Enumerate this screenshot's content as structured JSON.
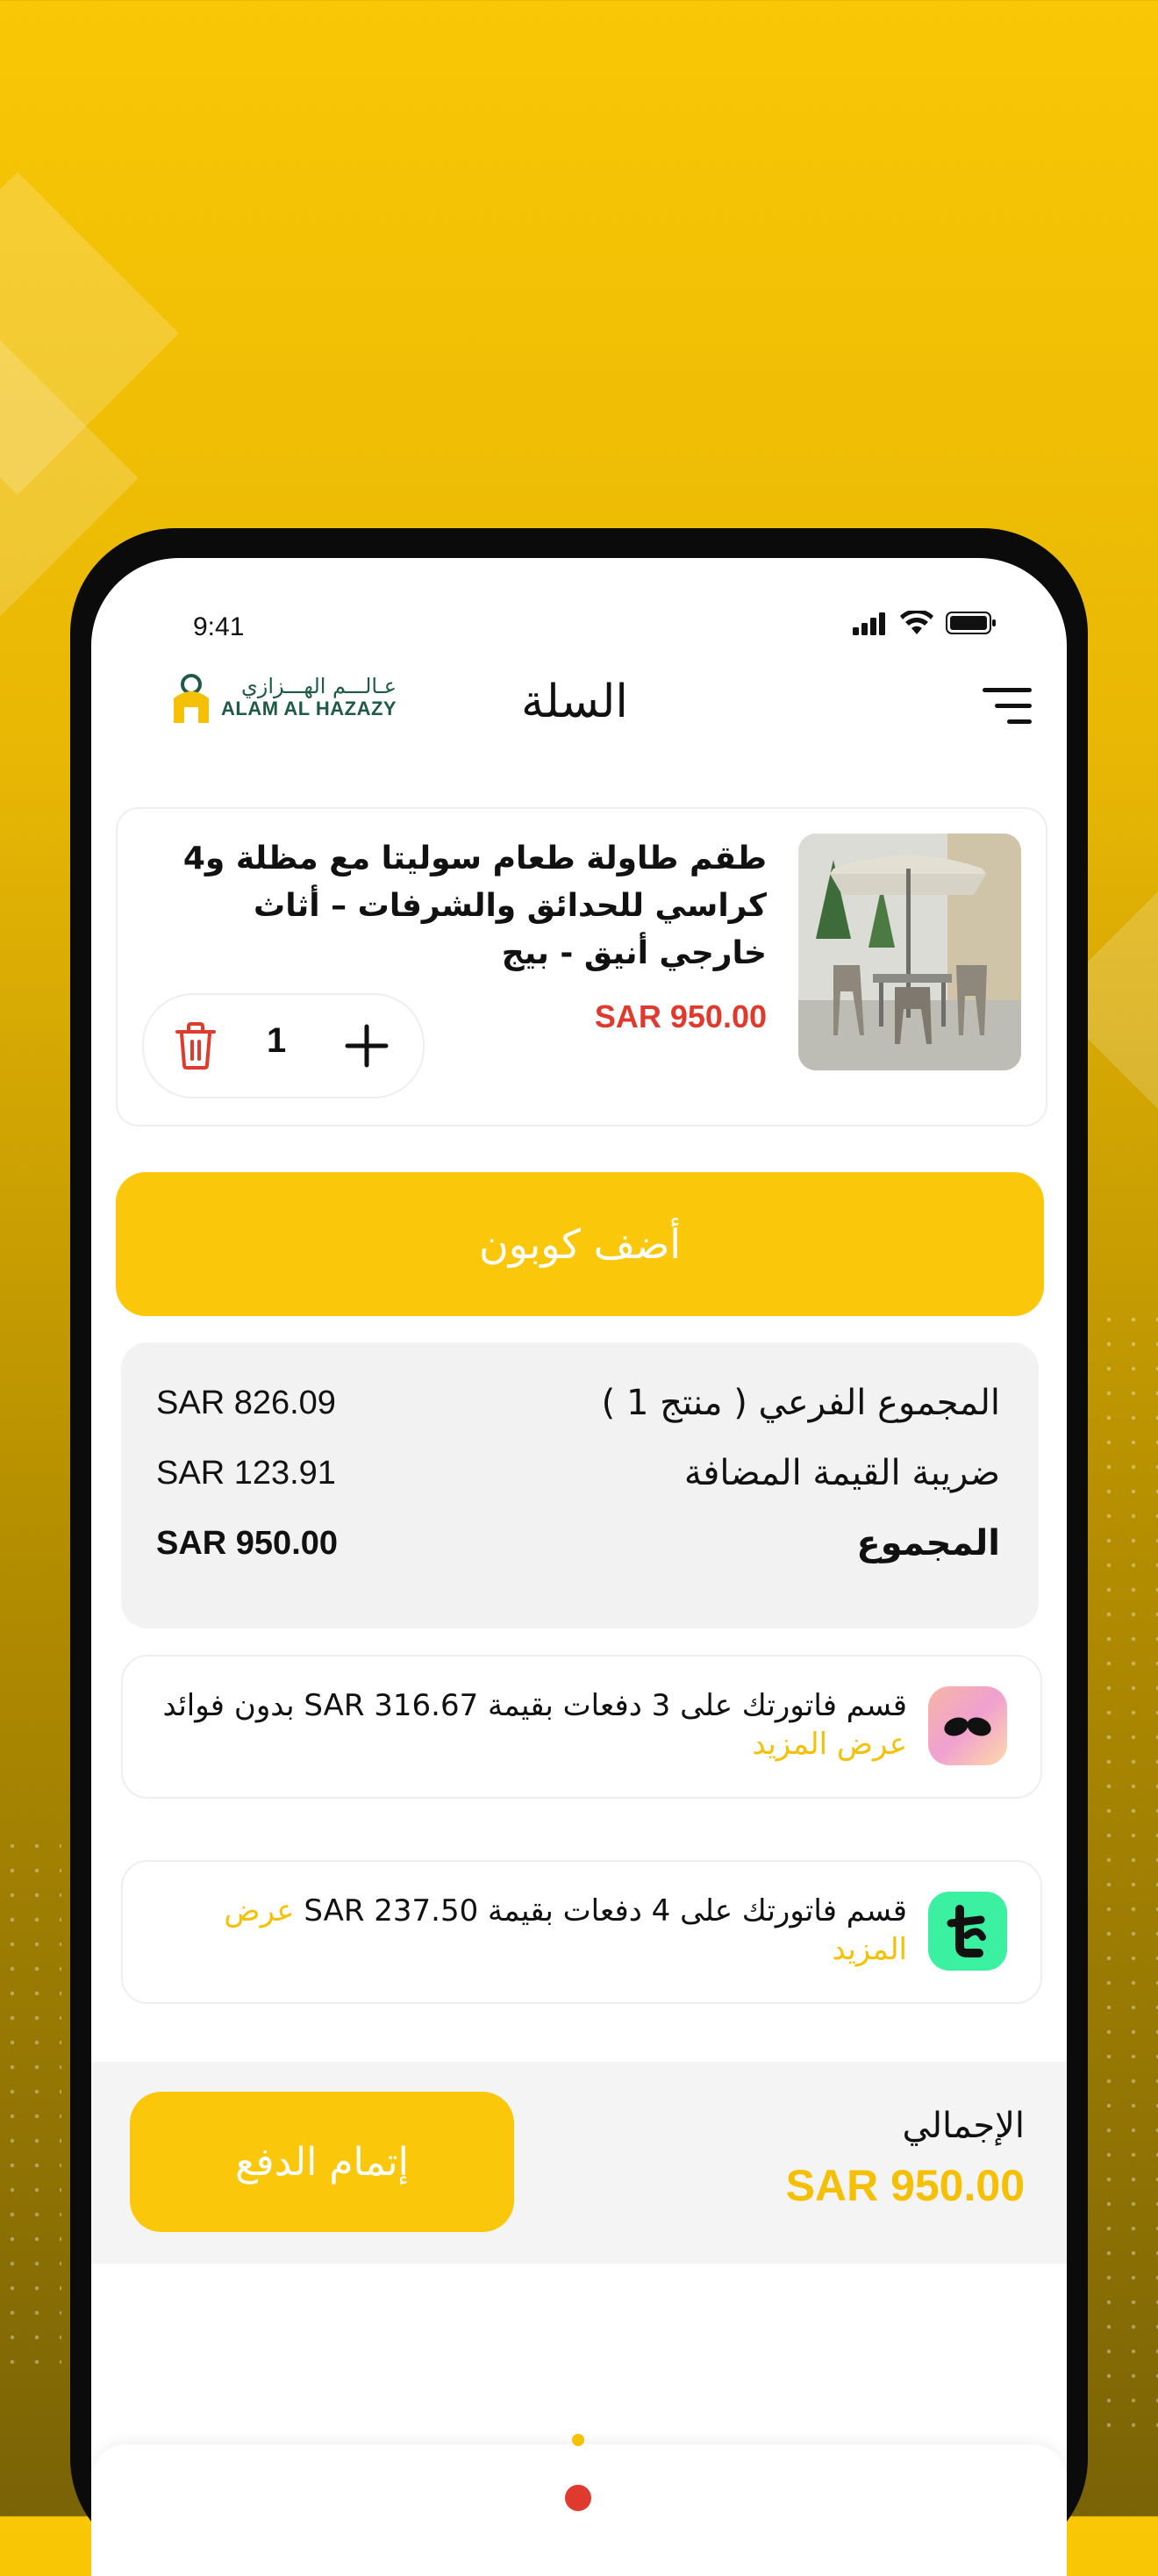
{
  "status_bar": {
    "time": "9:41"
  },
  "header": {
    "logo_ar": "عـالـــم الهـــزازي",
    "logo_en": "ALAM AL HAZAZY",
    "title": "السلة"
  },
  "cart_item": {
    "name": "طقم طاولة طعام سوليتا مع مظلة و4 كراسي للحدائق والشرفات – أثاث خارجي أنيق - بيج",
    "price": "SAR 950.00",
    "quantity": "1"
  },
  "coupon_button": "أضف كوبون",
  "summary": {
    "subtotal_label": "المجموع الفرعي ( منتج 1 )",
    "subtotal_value": "SAR 826.09",
    "vat_label": "ضريبة القيمة المضافة",
    "vat_value": "SAR 123.91",
    "total_label": "المجموع",
    "total_value": "SAR 950.00"
  },
  "installments": [
    {
      "provider_icon": "tamara-icon",
      "text": "قسم فاتورتك على 3 دفعات بقيمة SAR 316.67 بدون فوائد",
      "more": "عرض المزيد"
    },
    {
      "provider_icon": "tabby-icon",
      "text": "قسم فاتورتك على 4 دفعات بقيمة SAR 237.50",
      "more": "عرض المزيد"
    }
  ],
  "checkout": {
    "button": "إتمام الدفع",
    "grand_total_label": "الإجمالي",
    "grand_total_value": "SAR 950.00"
  },
  "colors": {
    "brand_yellow": "#fbc70a",
    "price_red": "#e03a2e",
    "logo_green": "#1f5a47"
  }
}
